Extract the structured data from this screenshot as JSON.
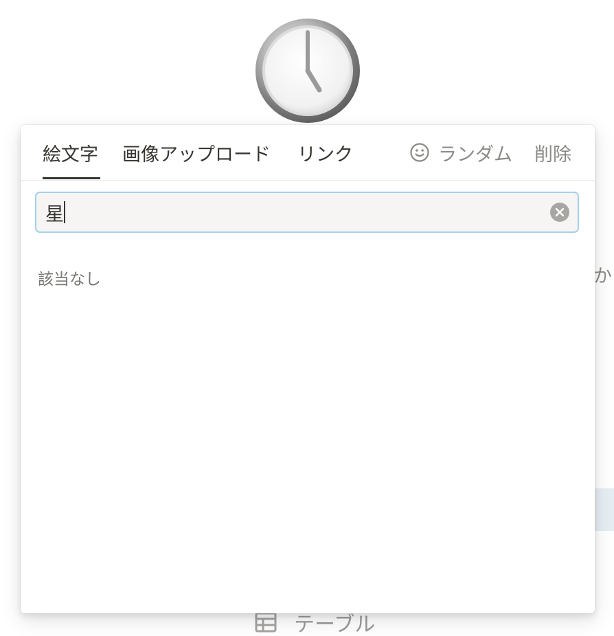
{
  "background": {
    "partial_text": "か",
    "table_label": "テーブル"
  },
  "popover": {
    "tabs": {
      "emoji": "絵文字",
      "upload": "画像アップロード",
      "link": "リンク"
    },
    "actions": {
      "random": "ランダム",
      "remove": "削除"
    },
    "search": {
      "value": "星",
      "placeholder": ""
    },
    "empty_message": "該当なし"
  },
  "colors": {
    "accent_focus": "#a3d0ea",
    "text_primary": "#37352f",
    "text_secondary": "#8b8a86"
  },
  "icons": {
    "page_icon": "clock-icon",
    "random": "smile-icon",
    "clear": "clear-circle-icon",
    "table": "table-icon"
  }
}
